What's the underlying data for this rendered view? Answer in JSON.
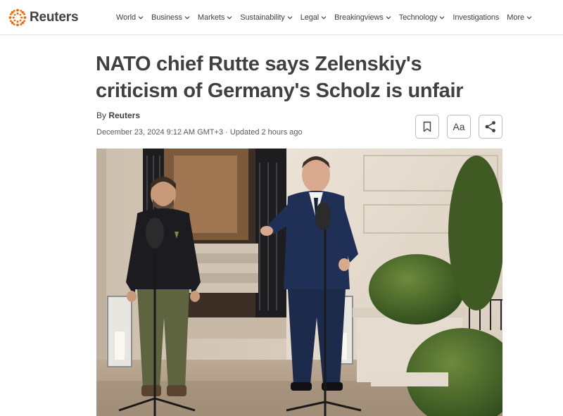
{
  "header": {
    "logo_text": "Reuters",
    "brand_color": "#fa6400",
    "nav": [
      {
        "label": "World",
        "has_dropdown": true
      },
      {
        "label": "Business",
        "has_dropdown": true
      },
      {
        "label": "Markets",
        "has_dropdown": true
      },
      {
        "label": "Sustainability",
        "has_dropdown": true
      },
      {
        "label": "Legal",
        "has_dropdown": true
      },
      {
        "label": "Breakingviews",
        "has_dropdown": true
      },
      {
        "label": "Technology",
        "has_dropdown": true
      },
      {
        "label": "Investigations",
        "has_dropdown": false
      },
      {
        "label": "More",
        "has_dropdown": true
      }
    ]
  },
  "article": {
    "headline_line1": "NATO chief Rutte says Zelenskiy's",
    "headline_line2": "criticism of Germany's Scholz is unfair",
    "byline_prefix": "By ",
    "byline_author": "Reuters",
    "date": "December 23, 2024 9:12 AM GMT+3",
    "separator": " · ",
    "updated": "Updated 2 hours ago",
    "tools": [
      {
        "name": "bookmark",
        "icon": "bookmark-icon"
      },
      {
        "name": "text-size",
        "label": "Aa"
      },
      {
        "name": "share",
        "icon": "share-icon"
      }
    ]
  }
}
